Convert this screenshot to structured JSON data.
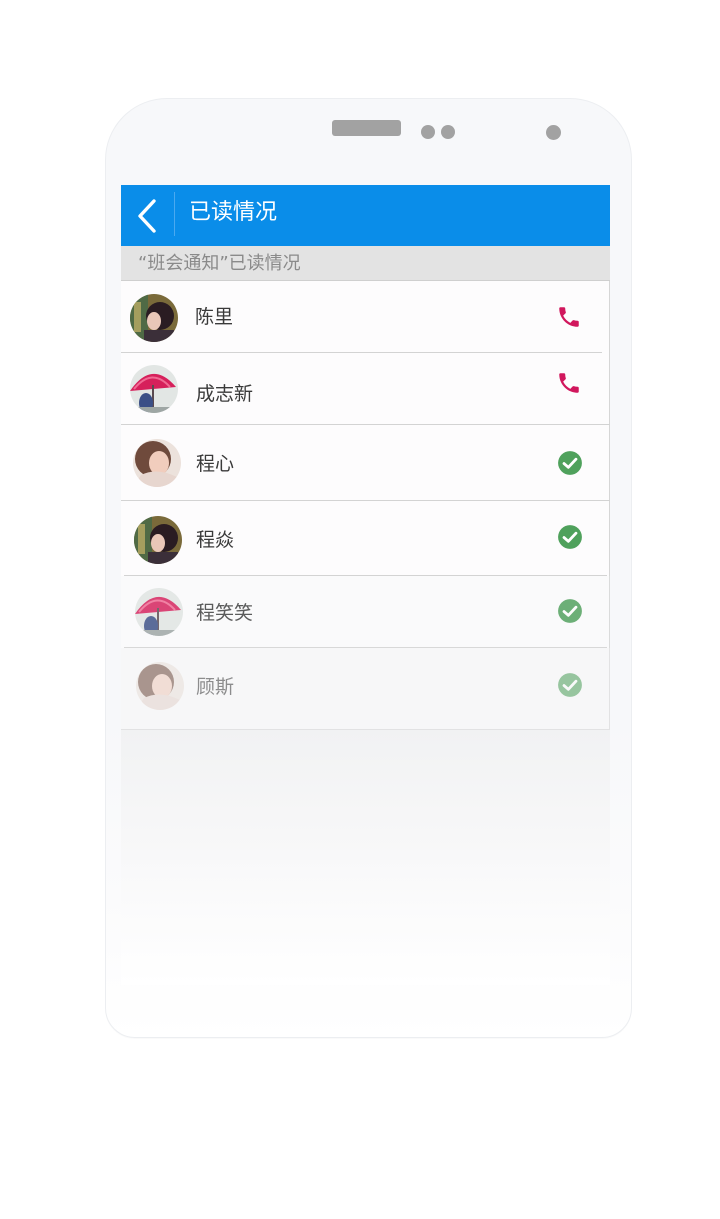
{
  "header": {
    "title": "已读情况",
    "back_icon": "chevron-left-icon"
  },
  "subheader": {
    "text": "“班会通知”已读情况"
  },
  "members": [
    {
      "name": "陈里",
      "status": "unread",
      "action_icon": "phone-icon"
    },
    {
      "name": "成志新",
      "status": "unread",
      "action_icon": "phone-icon"
    },
    {
      "name": "程心",
      "status": "read",
      "action_icon": "check-circle-icon"
    },
    {
      "name": "程焱",
      "status": "read",
      "action_icon": "check-circle-icon"
    },
    {
      "name": "程笑笑",
      "status": "read",
      "action_icon": "check-circle-icon"
    },
    {
      "name": "顾斯",
      "status": "read",
      "action_icon": "check-circle-icon"
    }
  ],
  "colors": {
    "appbar": "#0a8de9",
    "phone_icon": "#d1175d",
    "check_icon": "#4fa15c"
  }
}
